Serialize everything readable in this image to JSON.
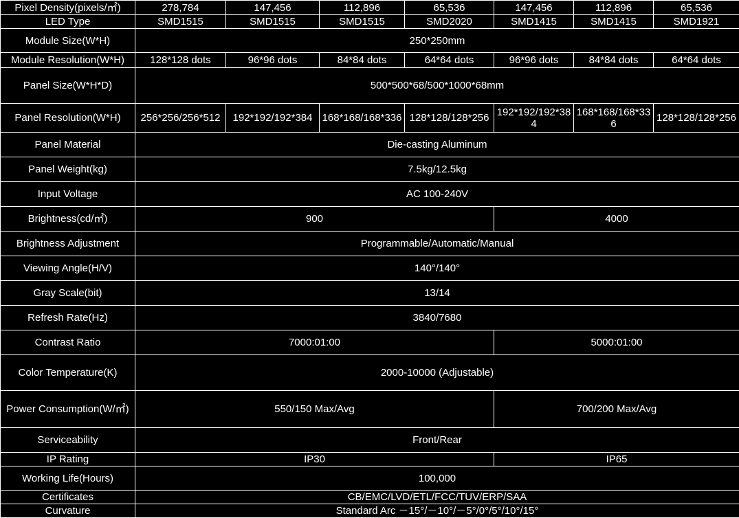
{
  "rows": [
    {
      "label": "Pixel Density(pixels/㎡)",
      "cells": [
        "278,784",
        "147,456",
        "112,896",
        "65,536",
        "147,456",
        "112,896",
        "65,536"
      ]
    },
    {
      "label": "LED Type",
      "cells": [
        "SMD1515",
        "SMD1515",
        "SMD1515",
        "SMD2020",
        "SMD1415",
        "SMD1415",
        "SMD1921"
      ]
    },
    {
      "label": "Module Size(W*H)",
      "value": "250*250mm"
    },
    {
      "label": "Module Resolution(W*H)",
      "cells": [
        "128*128 dots",
        "96*96 dots",
        "84*84 dots",
        "64*64 dots",
        "96*96 dots",
        "84*84 dots",
        "64*64 dots"
      ]
    },
    {
      "label": "Panel Size(W*H*D)",
      "value": "500*500*68/500*1000*68mm"
    },
    {
      "label": "Panel Resolution(W*H)",
      "cells": [
        "256*256/256*512",
        "192*192/192*384",
        "168*168/168*336",
        "128*128/128*256",
        "192*192/192*384",
        "168*168/168*336",
        "128*128/128*256"
      ]
    },
    {
      "label": "Panel Material",
      "value": "Die-casting Aluminum"
    },
    {
      "label": "Panel Weight(kg)",
      "value": "7.5kg/12.5kg"
    },
    {
      "label": "Input Voltage",
      "value": "AC 100-240V"
    },
    {
      "label": "Brightness(cd/㎡)",
      "left": "900",
      "right": "4000"
    },
    {
      "label": "Brightness Adjustment",
      "value": "Programmable/Automatic/Manual"
    },
    {
      "label": "Viewing Angle(H/V)",
      "value": "140°/140°"
    },
    {
      "label": "Gray Scale(bit)",
      "value": "13/14"
    },
    {
      "label": "Refresh Rate(Hz)",
      "value": "3840/7680"
    },
    {
      "label": "Contrast Ratio",
      "left": "7000:01:00",
      "right": "5000:01:00"
    },
    {
      "label": "Color Temperature(K)",
      "value": "2000-10000 (Adjustable)"
    },
    {
      "label": "Power Consumption(W/㎡)",
      "left": "550/150 Max/Avg",
      "right": "700/200 Max/Avg"
    },
    {
      "label": "Serviceability",
      "value": "Front/Rear"
    },
    {
      "label": "IP Rating",
      "left": "IP30",
      "right": "IP65"
    },
    {
      "label": "Working Life(Hours)",
      "value": "100,000"
    },
    {
      "label": "Certificates",
      "value": "CB/EMC/LVD/ETL/FCC/TUV/ERP/SAA"
    },
    {
      "label": "Curvature",
      "value": "Standard Arc －15°/－10°/－5°/0°/5°/10°/15°"
    }
  ]
}
